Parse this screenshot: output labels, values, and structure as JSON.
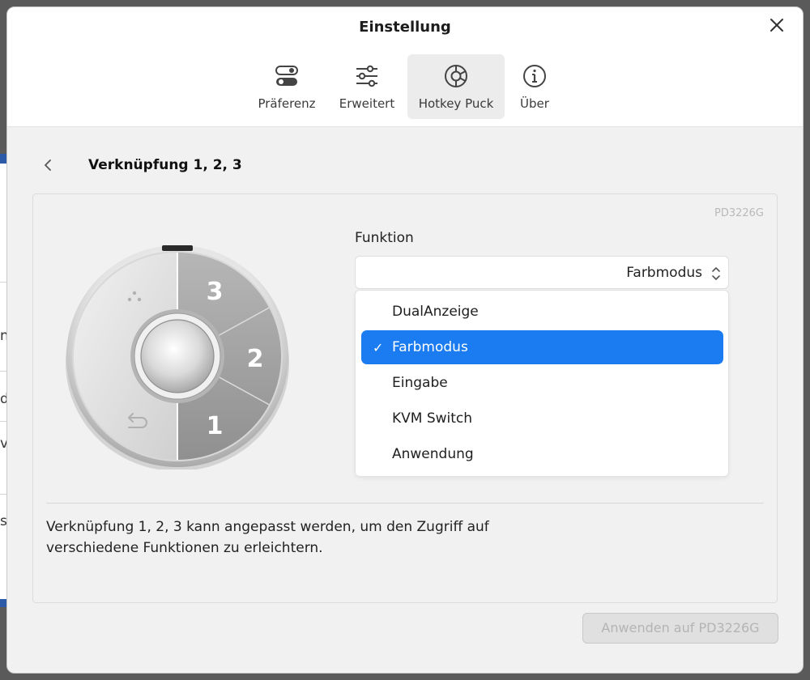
{
  "background": {
    "chars": [
      "n",
      "d",
      "v",
      "s"
    ]
  },
  "window": {
    "title": "Einstellung"
  },
  "tabs": [
    {
      "label": "Präferenz",
      "icon": "toggle-icon"
    },
    {
      "label": "Erweitert",
      "icon": "sliders-icon"
    },
    {
      "label": "Hotkey Puck",
      "icon": "puck-icon",
      "active": true
    },
    {
      "label": "Über",
      "icon": "info-icon"
    }
  ],
  "breadcrumb": {
    "title": "Verknüpfung 1, 2, 3"
  },
  "panel": {
    "model": "PD3226G",
    "puck_labels": [
      "3",
      "2",
      "1"
    ],
    "function_label": "Funktion",
    "selected_value": "Farbmodus",
    "options": [
      "DualAnzeige",
      "Farbmodus",
      "Eingabe",
      "KVM Switch",
      "Anwendung"
    ],
    "selected_index": 1,
    "check_mark": "✓",
    "description_line1": "Verknüpfung 1, 2, 3 kann angepasst werden, um den Zugriff auf",
    "description_line2": "verschiedene Funktionen zu erleichtern."
  },
  "apply_button": {
    "label": "Anwenden auf PD3226G",
    "disabled": true
  },
  "colors": {
    "accent": "#1a7cf0",
    "window_bg": "#f1f1f1",
    "header_bg": "#ffffff"
  }
}
